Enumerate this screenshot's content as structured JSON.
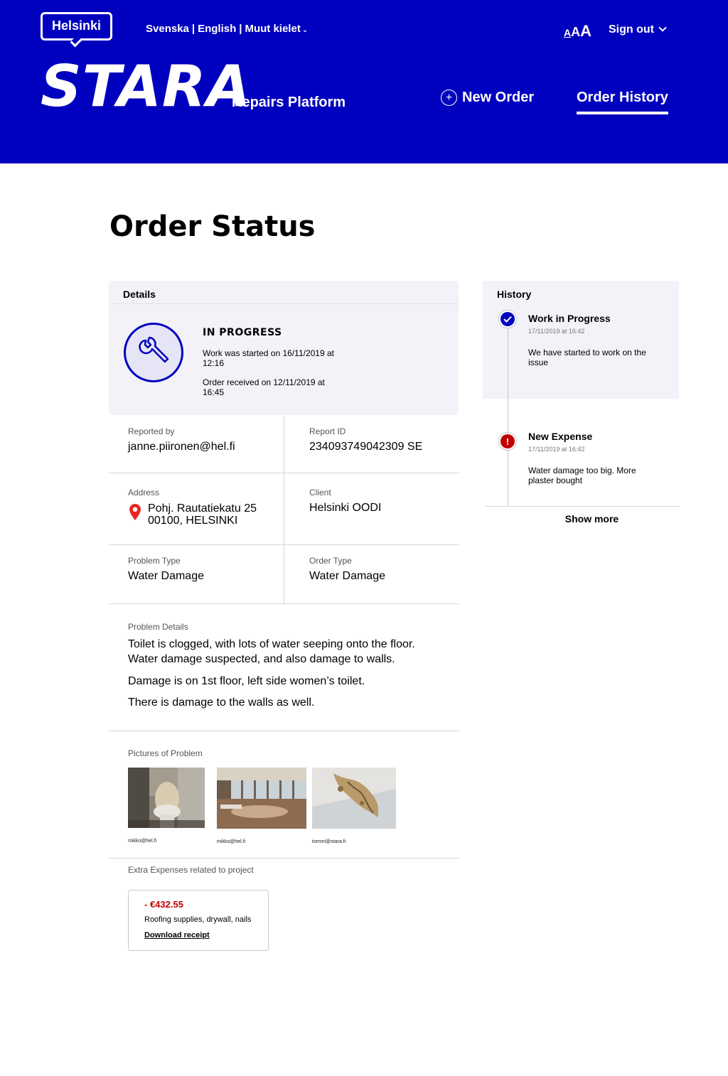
{
  "header": {
    "logo": "Helsinki",
    "languages": [
      "Svenska",
      "English",
      "Muut kielet"
    ],
    "font_size_control": [
      "A",
      "A",
      "A"
    ],
    "sign_out": "Sign out",
    "brand": "STARA",
    "subtitle": "Repairs Platform",
    "nav": {
      "new_order": "New Order",
      "order_history": "Order History"
    },
    "colors": {
      "brand_blue": "#0000bf",
      "alert_red": "#c00000"
    }
  },
  "page": {
    "title": "Order Status"
  },
  "details": {
    "heading": "Details",
    "status": "IN PROGRESS",
    "started": "Work was started on 16/11/2019 at 12:16",
    "received": "Order received on 12/11/2019 at 16:45",
    "status_icon": "wrench-icon",
    "reported_by": {
      "label": "Reported by",
      "value": "janne.piironen@hel.fi"
    },
    "report_id": {
      "label": "Report ID",
      "value": "234093749042309 SE"
    },
    "address": {
      "label": "Address",
      "line1": "Pohj. Rautatiekatu 25",
      "line2": "00100, HELSINKI"
    },
    "client": {
      "label": "Client",
      "value": "Helsinki OODI"
    },
    "problem_type": {
      "label": "Problem Type",
      "value": "Water Damage"
    },
    "order_type": {
      "label": "Order Type",
      "value": "Water Damage"
    },
    "problem_details": {
      "label": "Problem Details",
      "p1": "Toilet is clogged, with lots of water seeping onto the floor. Water damage suspected, and also damage to walls.",
      "p2": "Damage is on 1st floor, left side women’s toilet.",
      "p3": "There is damage to the walls as well."
    },
    "pictures": {
      "label": "Pictures of Problem",
      "items": [
        {
          "caption": "mikko@hel.fi"
        },
        {
          "caption": "mikko@hel.fi"
        },
        {
          "caption": "tommi@stara.fi"
        }
      ]
    },
    "expenses": {
      "label": "Extra Expenses related to project",
      "amount": "- €432.55",
      "description": "Roofing supplies, drywall, nails",
      "download": "Download receipt"
    }
  },
  "history": {
    "heading": "History",
    "items": [
      {
        "title": "Work in Progress",
        "date": "17/11/2019 at 16:42",
        "message": "We have started to work on the issue",
        "icon": "check-icon"
      },
      {
        "title": "New Expense",
        "date": "17/11/2019 at 16:42",
        "message": "Water damage too big. More plaster bought",
        "icon": "exclamation-icon"
      }
    ],
    "show_more": "Show more"
  }
}
